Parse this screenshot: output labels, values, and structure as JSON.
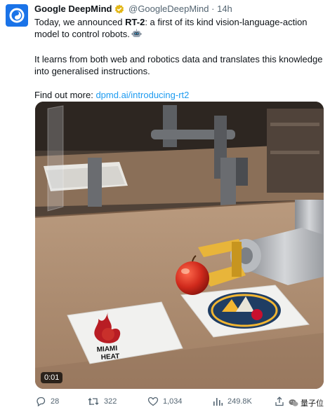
{
  "tweet": {
    "author_name": "Google DeepMind",
    "handle": "@GoogleDeepMind",
    "separator": "·",
    "time": "14h",
    "text": {
      "line1_prefix": "Today, we announced ",
      "line1_bold": "RT-2",
      "line1_suffix": ": a first of its kind vision-language-action model to control robots.",
      "paragraph2": "It learns from both web and robotics data and translates this knowledge into generalised instructions.",
      "paragraph3_prefix": "Find out more: ",
      "link": "dpmd.ai/introducing-rt2"
    },
    "media": {
      "video_time": "0:01",
      "card_left_text_line1": "MIAMI",
      "card_left_text_line2": "HEAT"
    },
    "actions": {
      "replies": "28",
      "retweets": "322",
      "likes": "1,034",
      "views": "249.8K"
    },
    "watermark": "量子位"
  },
  "colors": {
    "link": "#1d9bf0",
    "avatar": "#1a73e8",
    "verified": "#e2b719",
    "secondary_text": "#536471"
  },
  "icons": [
    "deepmind-logo-icon",
    "verified-badge-icon",
    "robot-emoji-icon",
    "reply-icon",
    "retweet-icon",
    "like-icon",
    "views-icon",
    "share-icon",
    "wechat-icon"
  ]
}
